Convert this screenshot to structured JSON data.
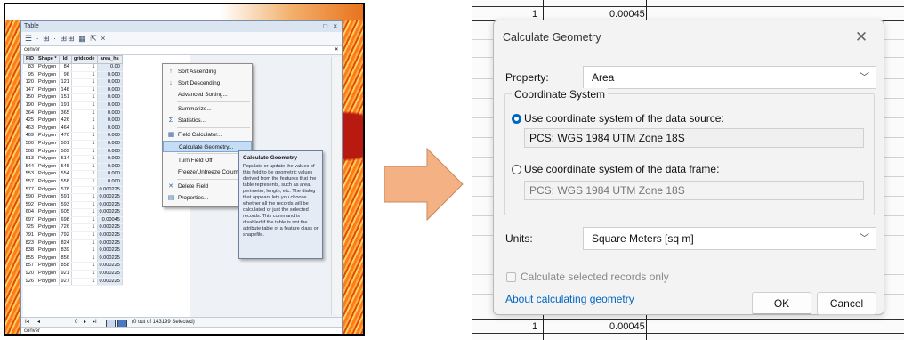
{
  "left": {
    "window_title": "Table",
    "window_buttons": "□ ×",
    "toolbar_icons": "☰ · ⊞ · ⊞⊞ ▦ ⇱ ×",
    "table_name": "conver",
    "tab_close": "×",
    "columns": [
      "FID",
      "Shape *",
      "Id",
      "gridcode",
      "area_hs"
    ],
    "rows": [
      [
        "83",
        "Polygon",
        "84",
        "1",
        "0.00"
      ],
      [
        "95",
        "Polygon",
        "96",
        "1",
        "0.000"
      ],
      [
        "120",
        "Polygon",
        "121",
        "1",
        "0.000"
      ],
      [
        "147",
        "Polygon",
        "148",
        "1",
        "0.000"
      ],
      [
        "150",
        "Polygon",
        "151",
        "1",
        "0.000"
      ],
      [
        "190",
        "Polygon",
        "191",
        "1",
        "0.000"
      ],
      [
        "364",
        "Polygon",
        "365",
        "1",
        "0.000"
      ],
      [
        "425",
        "Polygon",
        "426",
        "1",
        "0.000"
      ],
      [
        "463",
        "Polygon",
        "464",
        "1",
        "0.000"
      ],
      [
        "469",
        "Polygon",
        "470",
        "1",
        "0.000"
      ],
      [
        "500",
        "Polygon",
        "501",
        "1",
        "0.000"
      ],
      [
        "508",
        "Polygon",
        "509",
        "1",
        "0.000"
      ],
      [
        "513",
        "Polygon",
        "514",
        "1",
        "0.000"
      ],
      [
        "544",
        "Polygon",
        "545",
        "1",
        "0.000"
      ],
      [
        "553",
        "Polygon",
        "554",
        "1",
        "0.000"
      ],
      [
        "557",
        "Polygon",
        "558",
        "1",
        "0.000"
      ],
      [
        "577",
        "Polygon",
        "578",
        "1",
        "0.000225"
      ],
      [
        "590",
        "Polygon",
        "591",
        "1",
        "0.000225"
      ],
      [
        "592",
        "Polygon",
        "593",
        "1",
        "0.000225"
      ],
      [
        "604",
        "Polygon",
        "605",
        "1",
        "0.000225"
      ],
      [
        "697",
        "Polygon",
        "698",
        "1",
        "0.00045"
      ],
      [
        "725",
        "Polygon",
        "726",
        "1",
        "0.000225"
      ],
      [
        "791",
        "Polygon",
        "792",
        "1",
        "0.000225"
      ],
      [
        "823",
        "Polygon",
        "824",
        "1",
        "0.000225"
      ],
      [
        "838",
        "Polygon",
        "839",
        "1",
        "0.000225"
      ],
      [
        "855",
        "Polygon",
        "856",
        "1",
        "0.000225"
      ],
      [
        "857",
        "Polygon",
        "858",
        "1",
        "0.000225"
      ],
      [
        "920",
        "Polygon",
        "921",
        "1",
        "0.000225"
      ],
      [
        "926",
        "Polygon",
        "927",
        "1",
        "0.000225"
      ]
    ],
    "context_menu": [
      {
        "label": "Sort Ascending",
        "icon": "sort-ascending-icon",
        "glyph": "↑"
      },
      {
        "label": "Sort Descending",
        "icon": "sort-descending-icon",
        "glyph": "↓"
      },
      {
        "label": "Advanced Sorting...",
        "icon": "",
        "glyph": ""
      },
      {
        "label": "Summarize...",
        "icon": "",
        "glyph": ""
      },
      {
        "label": "Statistics...",
        "icon": "sigma-icon",
        "glyph": "Σ"
      },
      {
        "label": "Field Calculator...",
        "icon": "calculator-icon",
        "glyph": "▦"
      },
      {
        "label": "Calculate Geometry...",
        "icon": "",
        "glyph": ""
      },
      {
        "label": "Turn Field Off",
        "icon": "",
        "glyph": ""
      },
      {
        "label": "Freeze/Unfreeze Column",
        "icon": "",
        "glyph": ""
      },
      {
        "label": "Delete Field",
        "icon": "delete-icon",
        "glyph": "✕"
      },
      {
        "label": "Properties...",
        "icon": "properties-icon",
        "glyph": "▤"
      }
    ],
    "tooltip_title": "Calculate Geometry",
    "tooltip_body": "Populate or update the values of this field to be geometric values derived from the features that the table represents, such as area, perimeter, length, etc. The dialog that appears lets you choose whether all the records will be calculated or just the selected records. This command is disabled if the table is not the attribute table of a feature class or shapefile.",
    "nav_first": "I◂",
    "nav_prev": "◂",
    "nav_record": "0",
    "nav_next": "▸",
    "nav_last": "▸I",
    "selection_status": "(0 out of 143199 Selected)",
    "bottom_tab": "conver"
  },
  "arrow_color": "#f4b183",
  "right": {
    "bg_value_top": "1",
    "bg_area_top": "0.00045",
    "bg_value_bottom": "1",
    "bg_area_bottom": "0.00045",
    "dialog_title": "Calculate Geometry",
    "close_glyph": "✕",
    "property_label": "Property:",
    "property_value": "Area",
    "coord_system_legend": "Coordinate System",
    "radio_source_label": "Use coordinate system of the data source:",
    "source_pcs": "PCS: WGS 1984 UTM Zone 18S",
    "radio_frame_label": "Use coordinate system of the data frame:",
    "frame_pcs": "PCS: WGS 1984 UTM Zone 18S",
    "units_label": "Units:",
    "units_value": "Square Meters [sq m]",
    "calc_selected_label": "Calculate selected records only",
    "about_link": "About calculating geometry",
    "ok_label": "OK",
    "cancel_label": "Cancel",
    "accent_color": "#0067c0"
  }
}
